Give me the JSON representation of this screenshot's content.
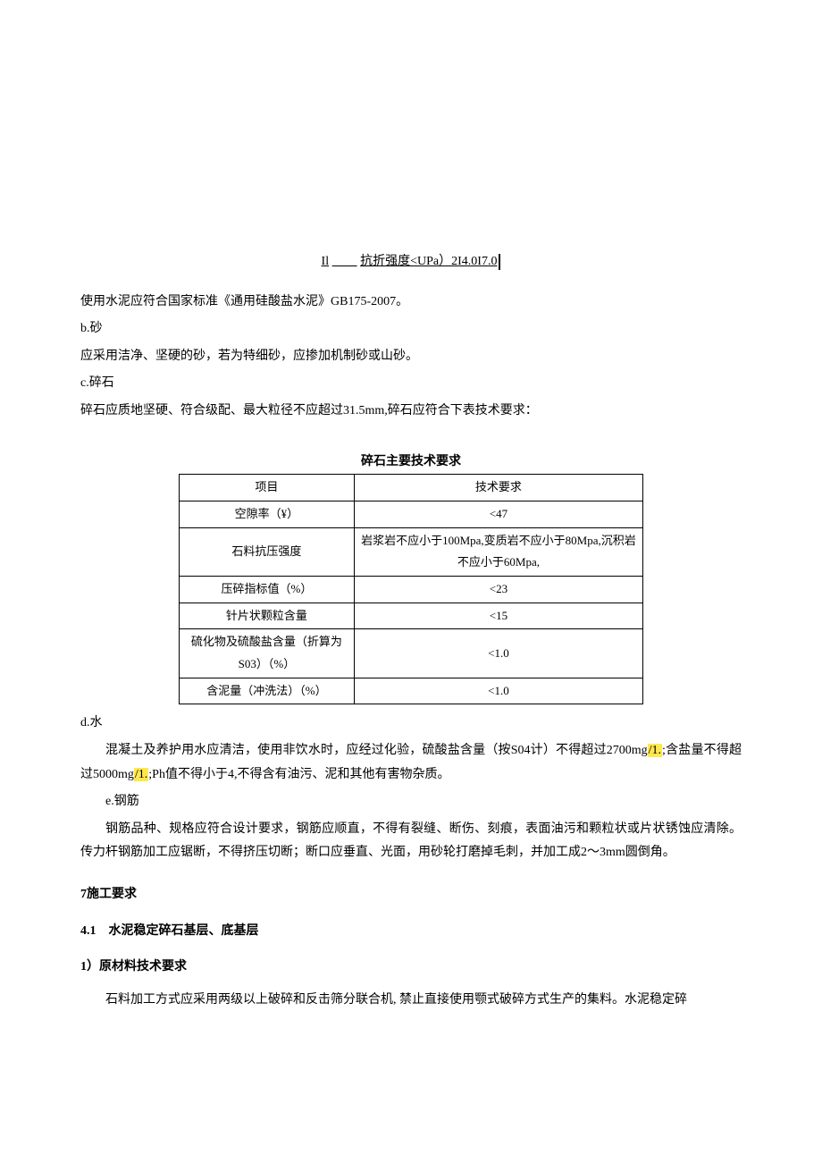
{
  "topline": {
    "left": "Il",
    "right": "抗折强度<UPa）2I4.0I7.0"
  },
  "p_cement": "使用水泥应符合国家标准《通用硅酸盐水泥》GB175-2007。",
  "p_b": "b.砂",
  "p_sand": "应采用洁净、坚硬的砂，若为特细砂，应掺加机制砂或山砂。",
  "p_c": "c.碎石",
  "p_stone_intro": "碎石应质地坚硬、符合级配、最大粒径不应超过31.5mm,碎石应符合下表技术要求：",
  "table_title": "碎石主要技术要求",
  "table": {
    "headers": [
      "项目",
      "技术要求"
    ],
    "rows": [
      [
        "空隙率（¥）",
        "<47"
      ],
      [
        "石料抗压强度",
        "岩浆岩不应小于100Mpa,变质岩不应小于80Mpa,沉积岩不应小于60Mpa,"
      ],
      [
        "压碎指标值（%）",
        "<23"
      ],
      [
        "针片状颗粒含量",
        "<15"
      ],
      [
        "硫化物及硫酸盐含量（折算为S03）（%）",
        "<1.0"
      ],
      [
        "含泥量（冲洗法）（%）",
        "<1.0"
      ]
    ]
  },
  "p_d": "d.水",
  "water": {
    "pre1": "混凝土及养护用水应清洁，使用非饮水时，应经过化验，硫酸盐含量（按S04计）不得超过2700mg",
    "hl1": "/1.",
    "mid": ";含盐量不得超过5000mg",
    "hl2": "/1.",
    "post": ";Ph值不得小于4,不得含有油污、泥和其他有害物杂质。"
  },
  "p_e": "e.钢筋",
  "p_rebar": "钢筋品种、规格应符合设计要求，钢筋应顺直，不得有裂缝、断伤、刻痕，表面油污和颗粒状或片状锈蚀应清除。传力杆钢筋加工应锯断，不得挤压切断；断口应垂直、光面，用砂轮打磨掉毛刺，并加工成2～3mm圆倒角。",
  "sec7": "7施工要求",
  "sec4_1": "4.1　水泥稳定碎石基层、底基层",
  "sec_raw": "1）原材料技术要求",
  "p_raw": "石料加工方式应采用两级以上破碎和反击筛分联合机, 禁止直接使用颚式破碎方式生产的集料。水泥稳定碎"
}
